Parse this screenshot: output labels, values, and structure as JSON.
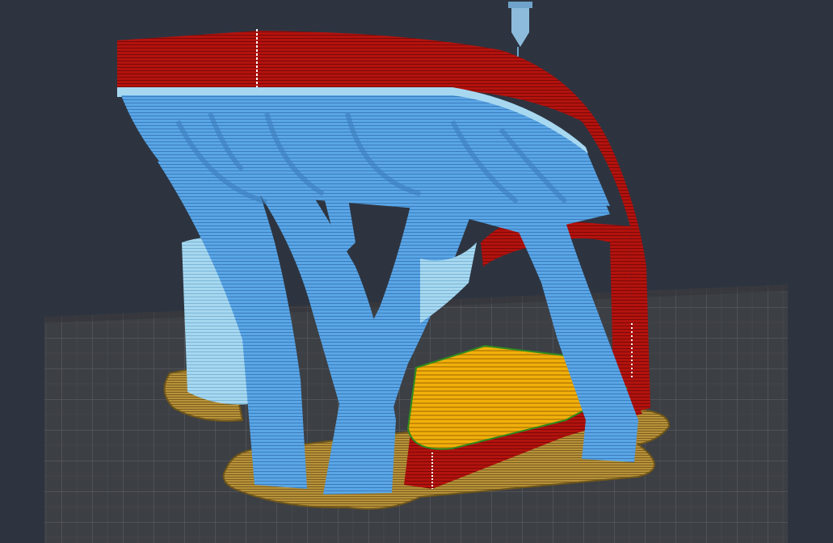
{
  "app": {
    "view": "layer-preview",
    "background_color": "#2d3440",
    "bed_color": "#3b3e43",
    "grid_color": "#55585e"
  },
  "scene": {
    "model_color": "#b3120e",
    "support_color": "#5aa6e6",
    "support_interface_color": "#a7d8f0",
    "top_infill_color": "#e8a808",
    "brim_color": "#a8862e",
    "nozzle_icon": "nozzle-icon"
  }
}
